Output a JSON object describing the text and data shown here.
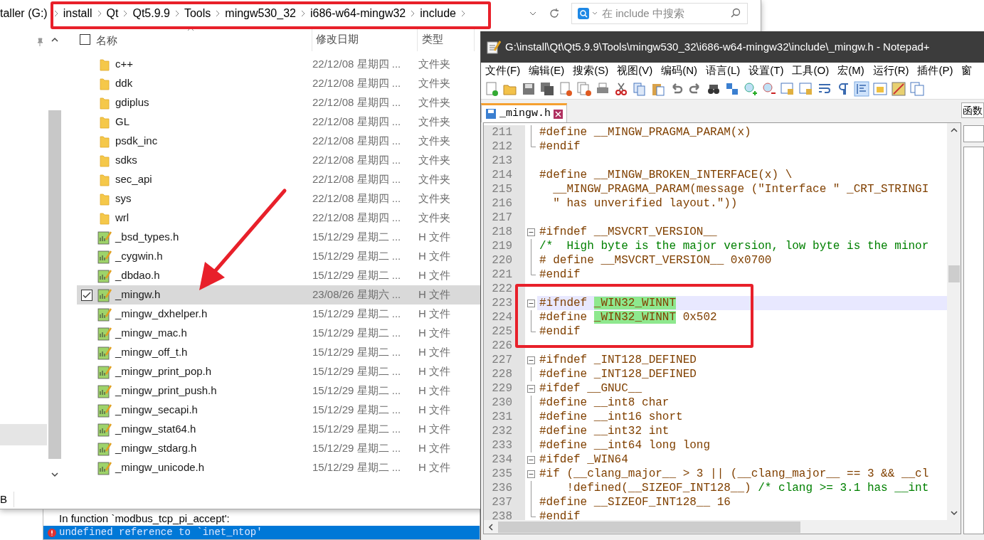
{
  "explorer": {
    "breadcrumb_cut": "taller (G:)",
    "breadcrumb": [
      "install",
      "Qt",
      "Qt5.9.9",
      "Tools",
      "mingw530_32",
      "i686-w64-mingw32",
      "include"
    ],
    "search": {
      "placeholder": "在 include 中搜索"
    },
    "select_all": {
      "checked": false
    },
    "columns": [
      "名称",
      "修改日期",
      "类型"
    ],
    "files": [
      {
        "kind": "folder",
        "name": "c++",
        "date": "22/12/08 星期四 ...",
        "type": "文件夹",
        "selected": false
      },
      {
        "kind": "folder",
        "name": "ddk",
        "date": "22/12/08 星期四 ...",
        "type": "文件夹",
        "selected": false
      },
      {
        "kind": "folder",
        "name": "gdiplus",
        "date": "22/12/08 星期四 ...",
        "type": "文件夹",
        "selected": false
      },
      {
        "kind": "folder",
        "name": "GL",
        "date": "22/12/08 星期四 ...",
        "type": "文件夹",
        "selected": false
      },
      {
        "kind": "folder",
        "name": "psdk_inc",
        "date": "22/12/08 星期四 ...",
        "type": "文件夹",
        "selected": false
      },
      {
        "kind": "folder",
        "name": "sdks",
        "date": "22/12/08 星期四 ...",
        "type": "文件夹",
        "selected": false
      },
      {
        "kind": "folder",
        "name": "sec_api",
        "date": "22/12/08 星期四 ...",
        "type": "文件夹",
        "selected": false
      },
      {
        "kind": "folder",
        "name": "sys",
        "date": "22/12/08 星期四 ...",
        "type": "文件夹",
        "selected": false
      },
      {
        "kind": "folder",
        "name": "wrl",
        "date": "22/12/08 星期四 ...",
        "type": "文件夹",
        "selected": false
      },
      {
        "kind": "file",
        "name": "_bsd_types.h",
        "date": "15/12/29 星期二 ...",
        "type": "H 文件",
        "selected": false
      },
      {
        "kind": "file",
        "name": "_cygwin.h",
        "date": "15/12/29 星期二 ...",
        "type": "H 文件",
        "selected": false
      },
      {
        "kind": "file",
        "name": "_dbdao.h",
        "date": "15/12/29 星期二 ...",
        "type": "H 文件",
        "selected": false
      },
      {
        "kind": "file",
        "name": "_mingw.h",
        "date": "23/08/26 星期六 ...",
        "type": "H 文件",
        "selected": true
      },
      {
        "kind": "file",
        "name": "_mingw_dxhelper.h",
        "date": "15/12/29 星期二 ...",
        "type": "H 文件",
        "selected": false
      },
      {
        "kind": "file",
        "name": "_mingw_mac.h",
        "date": "15/12/29 星期二 ...",
        "type": "H 文件",
        "selected": false
      },
      {
        "kind": "file",
        "name": "_mingw_off_t.h",
        "date": "15/12/29 星期二 ...",
        "type": "H 文件",
        "selected": false
      },
      {
        "kind": "file",
        "name": "_mingw_print_pop.h",
        "date": "15/12/29 星期二 ...",
        "type": "H 文件",
        "selected": false
      },
      {
        "kind": "file",
        "name": "_mingw_print_push.h",
        "date": "15/12/29 星期二 ...",
        "type": "H 文件",
        "selected": false
      },
      {
        "kind": "file",
        "name": "_mingw_secapi.h",
        "date": "15/12/29 星期二 ...",
        "type": "H 文件",
        "selected": false
      },
      {
        "kind": "file",
        "name": "_mingw_stat64.h",
        "date": "15/12/29 星期二 ...",
        "type": "H 文件",
        "selected": false
      },
      {
        "kind": "file",
        "name": "_mingw_stdarg.h",
        "date": "15/12/29 星期二 ...",
        "type": "H 文件",
        "selected": false
      },
      {
        "kind": "file",
        "name": "_mingw_unicode.h",
        "date": "15/12/29 星期二 ...",
        "type": "H 文件",
        "selected": false
      }
    ],
    "status": "B"
  },
  "output_panel": {
    "rows": [
      {
        "kind": "info",
        "text": "In function `modbus_tcp_pi_accept':",
        "selected": false
      },
      {
        "kind": "error",
        "text": "undefined reference to `inet_ntop'",
        "selected": true
      }
    ]
  },
  "notepad": {
    "title": "G:\\install\\Qt\\Qt5.9.9\\Tools\\mingw530_32\\i686-w64-mingw32\\include\\_mingw.h - Notepad+",
    "menu": [
      "文件(F)",
      "编辑(E)",
      "搜索(S)",
      "视图(V)",
      "编码(N)",
      "语言(L)",
      "设置(T)",
      "工具(O)",
      "宏(M)",
      "运行(R)",
      "插件(P)",
      "窗"
    ],
    "tabs": [
      {
        "label": "_mingw.h",
        "selected": true
      }
    ],
    "side_tab": "函数",
    "lines": [
      {
        "number": "211",
        "kind": "fold-body",
        "current": false,
        "segments": [
          {
            "kind": "pre",
            "text": "#define __MINGW_PRAGMA_PARAM(x)"
          }
        ]
      },
      {
        "number": "212",
        "kind": "fold-end",
        "current": false,
        "segments": [
          {
            "kind": "pre",
            "text": "#endif"
          }
        ]
      },
      {
        "number": "213",
        "kind": "plain",
        "current": false
      },
      {
        "number": "214",
        "kind": "plain",
        "current": false,
        "segments": [
          {
            "kind": "pre",
            "text": "#define __MINGW_BROKEN_INTERFACE(x) \\"
          }
        ]
      },
      {
        "number": "215",
        "kind": "plain",
        "current": false,
        "segments": [
          {
            "kind": "pre",
            "text": "  __MINGW_PRAGMA_PARAM(message (\"Interface \" _CRT_STRINGI"
          }
        ]
      },
      {
        "number": "216",
        "kind": "plain",
        "current": false,
        "segments": [
          {
            "kind": "pre",
            "text": "  \" has unverified layout.\"))"
          }
        ]
      },
      {
        "number": "217",
        "kind": "plain",
        "current": false
      },
      {
        "number": "218",
        "kind": "fold-start",
        "current": false,
        "segments": [
          {
            "kind": "pre",
            "text": "#ifndef __MSVCRT_VERSION__"
          }
        ]
      },
      {
        "number": "219",
        "kind": "fold-body",
        "current": false,
        "segments": [
          {
            "kind": "comment",
            "text": "/*  High byte is the major version, low byte is the minor"
          }
        ]
      },
      {
        "number": "220",
        "kind": "fold-body",
        "current": false,
        "segments": [
          {
            "kind": "pre",
            "text": "# define __MSVCRT_VERSION__ 0x0700"
          }
        ]
      },
      {
        "number": "221",
        "kind": "fold-end",
        "current": false,
        "segments": [
          {
            "kind": "pre",
            "text": "#endif"
          }
        ]
      },
      {
        "number": "222",
        "kind": "plain",
        "current": false
      },
      {
        "number": "223",
        "kind": "fold-start",
        "current": true,
        "segments": [
          {
            "kind": "pre",
            "text": "#ifndef "
          },
          {
            "kind": "match",
            "text": "_WIN32_WINNT"
          }
        ]
      },
      {
        "number": "224",
        "kind": "fold-body",
        "current": false,
        "segments": [
          {
            "kind": "pre",
            "text": "#define "
          },
          {
            "kind": "match",
            "text": "_WIN32_WINNT"
          },
          {
            "kind": "pre",
            "text": " 0x502"
          }
        ]
      },
      {
        "number": "225",
        "kind": "fold-end",
        "current": false,
        "segments": [
          {
            "kind": "pre",
            "text": "#endif"
          }
        ]
      },
      {
        "number": "226",
        "kind": "plain",
        "current": false
      },
      {
        "number": "227",
        "kind": "fold-start",
        "current": false,
        "segments": [
          {
            "kind": "pre",
            "text": "#ifndef _INT128_DEFINED"
          }
        ]
      },
      {
        "number": "228",
        "kind": "fold-body",
        "current": false,
        "segments": [
          {
            "kind": "pre",
            "text": "#define _INT128_DEFINED"
          }
        ]
      },
      {
        "number": "229",
        "kind": "fold-start",
        "current": false,
        "segments": [
          {
            "kind": "pre",
            "text": "#ifdef __GNUC__"
          }
        ]
      },
      {
        "number": "230",
        "kind": "fold-body",
        "current": false,
        "segments": [
          {
            "kind": "pre",
            "text": "#define __int8 char"
          }
        ]
      },
      {
        "number": "231",
        "kind": "fold-body",
        "current": false,
        "segments": [
          {
            "kind": "pre",
            "text": "#define __int16 short"
          }
        ]
      },
      {
        "number": "232",
        "kind": "fold-body",
        "current": false,
        "segments": [
          {
            "kind": "pre",
            "text": "#define __int32 int"
          }
        ]
      },
      {
        "number": "233",
        "kind": "fold-body",
        "current": false,
        "segments": [
          {
            "kind": "pre",
            "text": "#define __int64 long long"
          }
        ]
      },
      {
        "number": "234",
        "kind": "fold-start",
        "current": false,
        "segments": [
          {
            "kind": "pre",
            "text": "#ifdef _WIN64"
          }
        ]
      },
      {
        "number": "235",
        "kind": "fold-start",
        "current": false,
        "segments": [
          {
            "kind": "pre",
            "text": "#if (__clang_major__ > 3 || (__clang_major__ == 3 && __cl"
          }
        ]
      },
      {
        "number": "236",
        "kind": "fold-body",
        "current": false,
        "segments": [
          {
            "kind": "pre",
            "text": "    !defined(__SIZEOF_INT128__) "
          },
          {
            "kind": "comment",
            "text": "/* clang >= 3.1 has __int"
          }
        ]
      },
      {
        "number": "237",
        "kind": "fold-body",
        "current": false,
        "segments": [
          {
            "kind": "pre",
            "text": "#define __SIZEOF_INT128__ 16"
          }
        ]
      },
      {
        "number": "238",
        "kind": "fold-end",
        "current": false,
        "segments": [
          {
            "kind": "pre",
            "text": "#endif"
          }
        ]
      }
    ]
  }
}
